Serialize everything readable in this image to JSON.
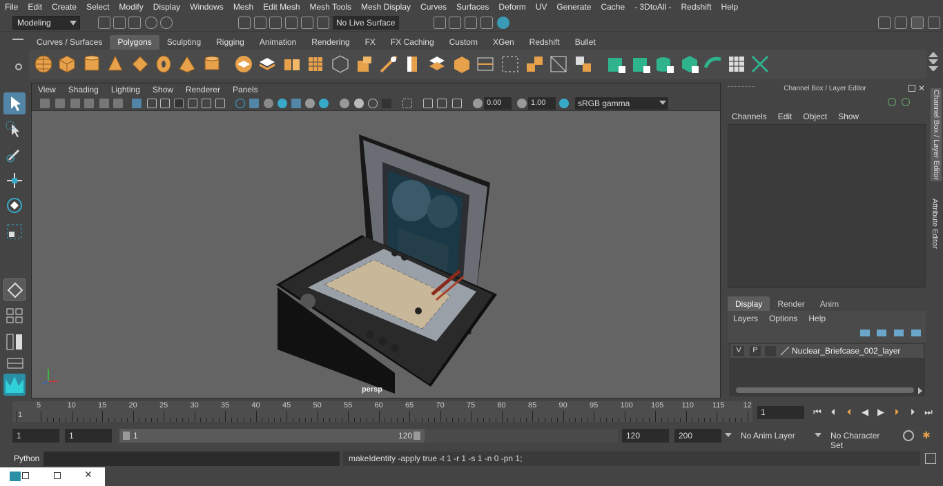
{
  "menu": [
    "File",
    "Edit",
    "Create",
    "Select",
    "Modify",
    "Display",
    "Windows",
    "Mesh",
    "Edit Mesh",
    "Mesh Tools",
    "Mesh Display",
    "Curves",
    "Surfaces",
    "Deform",
    "UV",
    "Generate",
    "Cache",
    "- 3DtoAll -",
    "Redshift",
    "Help"
  ],
  "status": {
    "mode": "Modeling",
    "live_surface": "No Live Surface"
  },
  "shelf_tabs": [
    "Curves / Surfaces",
    "Polygons",
    "Sculpting",
    "Rigging",
    "Animation",
    "Rendering",
    "FX",
    "FX Caching",
    "Custom",
    "XGen",
    "Redshift",
    "Bullet"
  ],
  "active_shelf": "Polygons",
  "viewport": {
    "menu": [
      "View",
      "Shading",
      "Lighting",
      "Show",
      "Renderer",
      "Panels"
    ],
    "exposure": "0.00",
    "gamma_value": "1.00",
    "color_space": "sRGB gamma",
    "camera_label": "persp"
  },
  "channel_box": {
    "title": "Channel Box / Layer Editor",
    "menu": [
      "Channels",
      "Edit",
      "Object",
      "Show"
    ],
    "tabs": [
      "Display",
      "Render",
      "Anim"
    ],
    "active_tab": "Display",
    "layer_menu": [
      "Layers",
      "Options",
      "Help"
    ],
    "layer": {
      "v": "V",
      "p": "P",
      "name": "Nuclear_Briefcase_002_layer"
    }
  },
  "side_tabs": [
    "Channel Box / Layer Editor",
    "Attribute Editor"
  ],
  "timeline": {
    "ticks": [
      "1",
      "5",
      "10",
      "15",
      "20",
      "25",
      "30",
      "35",
      "40",
      "45",
      "50",
      "55",
      "60",
      "65",
      "70",
      "75",
      "80",
      "85",
      "90",
      "95",
      "100",
      "105",
      "110",
      "115",
      "12"
    ],
    "current_frame": "1"
  },
  "range": {
    "start": "1",
    "playback_start": "1",
    "slider_start": "1",
    "slider_end": "120",
    "end": "120",
    "anim_end": "200",
    "anim_layer": "No Anim Layer",
    "character_set": "No Character Set"
  },
  "command": {
    "lang": "Python",
    "result": "makeIdentity -apply true -t 1 -r 1 -s 1 -n 0 -pn 1;"
  },
  "colors": {
    "accent": "#5285a6",
    "shelf_orange": "#e8a14b",
    "shelf_green": "#2fb38c",
    "viewport_bg": "#646464"
  }
}
